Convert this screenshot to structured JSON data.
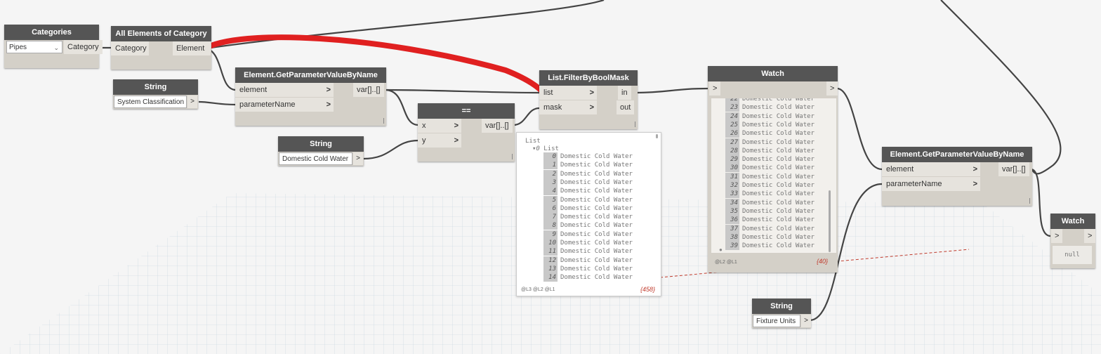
{
  "nodes": {
    "categories": {
      "title": "Categories",
      "dropdown_value": "Pipes",
      "output": "Category"
    },
    "all_elements": {
      "title": "All Elements of Category",
      "input": "Category",
      "output": "Element"
    },
    "string1": {
      "title": "String",
      "value": "System Classification",
      "output": ">"
    },
    "string2": {
      "title": "String",
      "value": "Domestic Cold Water",
      "output": ">"
    },
    "string3": {
      "title": "String",
      "value": "Fixture Units",
      "output": ">"
    },
    "getparam1": {
      "title": "Element.GetParameterValueByName",
      "input1": "element",
      "input2": "parameterName",
      "output": "var[]..[]"
    },
    "equals": {
      "title": "==",
      "input1": "x",
      "input2": "y",
      "output": "var[]..[]"
    },
    "filter": {
      "title": "List.FilterByBoolMask",
      "input1": "list",
      "input2": "mask",
      "output1": "in",
      "output2": "out"
    },
    "watch1": {
      "title": "Watch",
      "input": ">",
      "output": ">",
      "levels": "@L2 @L1",
      "count": "{40}"
    },
    "getparam2": {
      "title": "Element.GetParameterValueByName",
      "input1": "element",
      "input2": "parameterName",
      "output": "var[]..[]"
    },
    "watch2": {
      "title": "Watch",
      "input": ">",
      "output": ">",
      "value": "null"
    }
  },
  "watch1_rows": [
    {
      "i": "22",
      "t": "Domestic Cold Water"
    },
    {
      "i": "23",
      "t": "Domestic Cold Water"
    },
    {
      "i": "24",
      "t": "Domestic Cold Water"
    },
    {
      "i": "25",
      "t": "Domestic Cold Water"
    },
    {
      "i": "26",
      "t": "Domestic Cold Water"
    },
    {
      "i": "27",
      "t": "Domestic Cold Water"
    },
    {
      "i": "28",
      "t": "Domestic Cold Water"
    },
    {
      "i": "29",
      "t": "Domestic Cold Water"
    },
    {
      "i": "30",
      "t": "Domestic Cold Water"
    },
    {
      "i": "31",
      "t": "Domestic Cold Water"
    },
    {
      "i": "32",
      "t": "Domestic Cold Water"
    },
    {
      "i": "33",
      "t": "Domestic Cold Water"
    },
    {
      "i": "34",
      "t": "Domestic Cold Water"
    },
    {
      "i": "35",
      "t": "Domestic Cold Water"
    },
    {
      "i": "36",
      "t": "Domestic Cold Water"
    },
    {
      "i": "37",
      "t": "Domestic Cold Water"
    },
    {
      "i": "38",
      "t": "Domestic Cold Water"
    },
    {
      "i": "39",
      "t": "Domestic Cold Water"
    }
  ],
  "preview": {
    "header": "List",
    "sub_index": "0",
    "sub_label": "List",
    "rows": [
      {
        "i": "0",
        "t": "Domestic Cold Water"
      },
      {
        "i": "1",
        "t": "Domestic Cold Water"
      },
      {
        "i": "2",
        "t": "Domestic Cold Water"
      },
      {
        "i": "3",
        "t": "Domestic Cold Water"
      },
      {
        "i": "4",
        "t": "Domestic Cold Water"
      },
      {
        "i": "5",
        "t": "Domestic Cold Water"
      },
      {
        "i": "6",
        "t": "Domestic Cold Water"
      },
      {
        "i": "7",
        "t": "Domestic Cold Water"
      },
      {
        "i": "8",
        "t": "Domestic Cold Water"
      },
      {
        "i": "9",
        "t": "Domestic Cold Water"
      },
      {
        "i": "10",
        "t": "Domestic Cold Water"
      },
      {
        "i": "11",
        "t": "Domestic Cold Water"
      },
      {
        "i": "12",
        "t": "Domestic Cold Water"
      },
      {
        "i": "13",
        "t": "Domestic Cold Water"
      },
      {
        "i": "14",
        "t": "Domestic Cold Water"
      }
    ],
    "levels": "@L3 @L2 @L1",
    "count": "{458}"
  },
  "colors": {
    "node_title": "#555555",
    "node_body": "#d4d0c8",
    "wire": "#444444",
    "highlight_wire": "#e02020",
    "grid": "#9ab8cc"
  }
}
